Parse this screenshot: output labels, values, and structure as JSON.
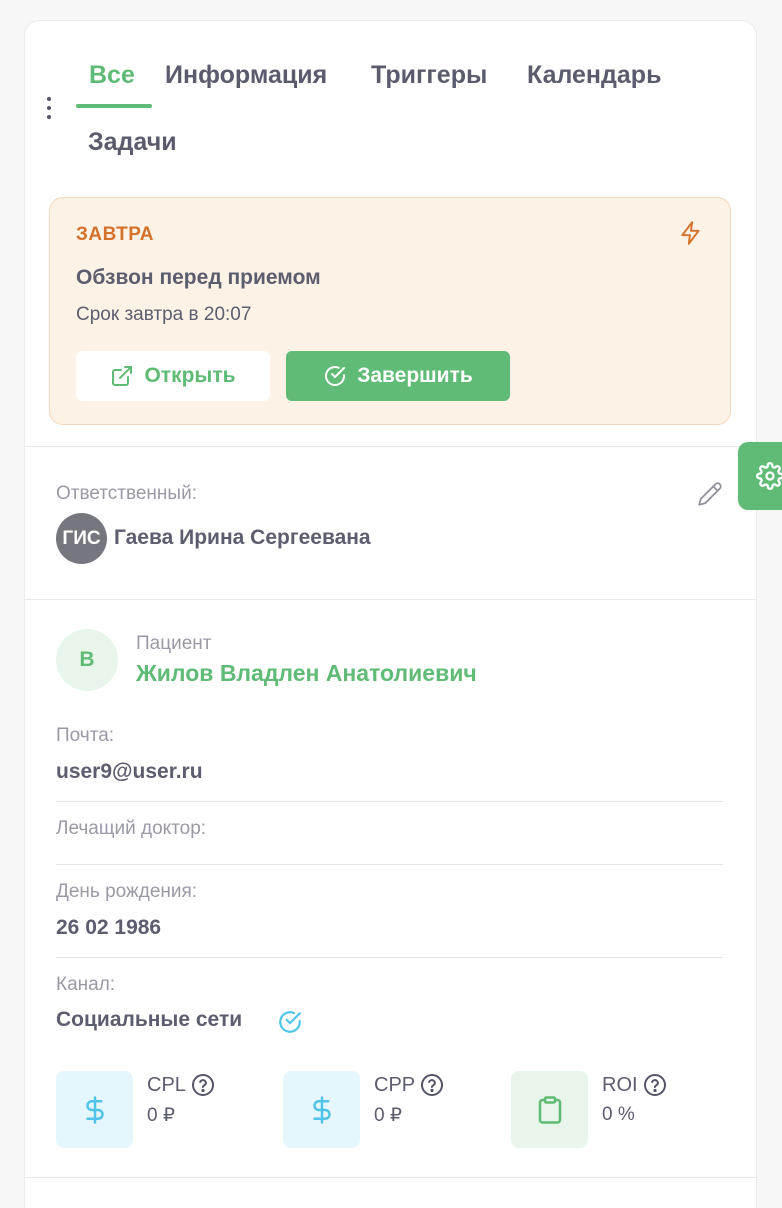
{
  "tabs": [
    {
      "label": "Все",
      "active": true
    },
    {
      "label": "Информация"
    },
    {
      "label": "Триггеры"
    },
    {
      "label": "Календарь"
    },
    {
      "label": "Задачи"
    }
  ],
  "task": {
    "when": "ЗАВТРА",
    "title": "Обзвон перед приемом",
    "due": "Срок завтра в 20:07",
    "open_label": "Открыть",
    "complete_label": "Завершить",
    "icon": "lightning-icon"
  },
  "responsible": {
    "label": "Ответственный:",
    "initials": "ГИС",
    "name": "Гаева Ирина Сергеевана"
  },
  "patient": {
    "avatar_letter": "В",
    "label": "Пациент",
    "name": "Жилов Владлен Анатолиевич"
  },
  "fields": {
    "email": {
      "label": "Почта:",
      "value": "user9@user.ru"
    },
    "doctor": {
      "label": "Лечащий доктор:"
    },
    "birthday": {
      "label": "День рождения:",
      "value": "26 02 1986"
    },
    "channel": {
      "label": "Канал:",
      "value": "Социальные сети"
    }
  },
  "metrics": [
    {
      "name": "CPL",
      "value": "0 ₽",
      "icon": "dollar-icon"
    },
    {
      "name": "CPP",
      "value": "0 ₽",
      "icon": "dollar-icon"
    },
    {
      "name": "ROI",
      "value": "0 %",
      "icon": "clipboard-icon"
    }
  ],
  "colors": {
    "accent": "#5fbb75",
    "warning_bg": "#fdf2e6",
    "warning_text": "#d4712b",
    "info": "#4fc3e8"
  }
}
